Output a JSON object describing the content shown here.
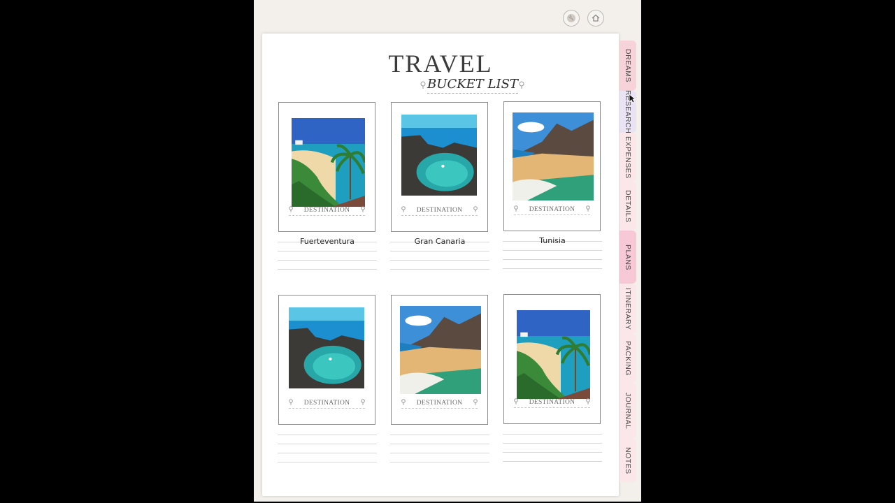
{
  "header": {
    "globe_icon": "globe-icon",
    "home_icon": "home-icon"
  },
  "page": {
    "title": "TRAVEL",
    "subtitle": "BUCKET LIST",
    "cards": [
      {
        "label": "DESTINATION",
        "name": "Fuerteventura",
        "photo": "palm-beach"
      },
      {
        "label": "DESTINATION",
        "name": "Gran Canaria",
        "photo": "rock-pool"
      },
      {
        "label": "DESTINATION",
        "name": "Tunisia",
        "photo": "mountain-beach"
      },
      {
        "label": "DESTINATION",
        "name": "",
        "photo": "rock-pool"
      },
      {
        "label": "DESTINATION",
        "name": "",
        "photo": "mountain-beach"
      },
      {
        "label": "DESTINATION",
        "name": "",
        "photo": "palm-beach"
      }
    ]
  },
  "tabs": [
    {
      "label": "DREAMS",
      "color": "#f6d2d9"
    },
    {
      "label": "RESEARCH",
      "color": "#eae3f4"
    },
    {
      "label": "EXPENSES",
      "color": "#fbe7e9"
    },
    {
      "label": "DETAILS",
      "color": "#fbe7e9"
    },
    {
      "label": "PLANS",
      "color": "#f7c9d6"
    },
    {
      "label": "ITINERARY",
      "color": "#fbe7e9"
    },
    {
      "label": "PACKING",
      "color": "#fbe7e9"
    },
    {
      "label": "JOURNAL",
      "color": "#fbe7e9"
    },
    {
      "label": "NOTES",
      "color": "#fbe7e9"
    }
  ]
}
